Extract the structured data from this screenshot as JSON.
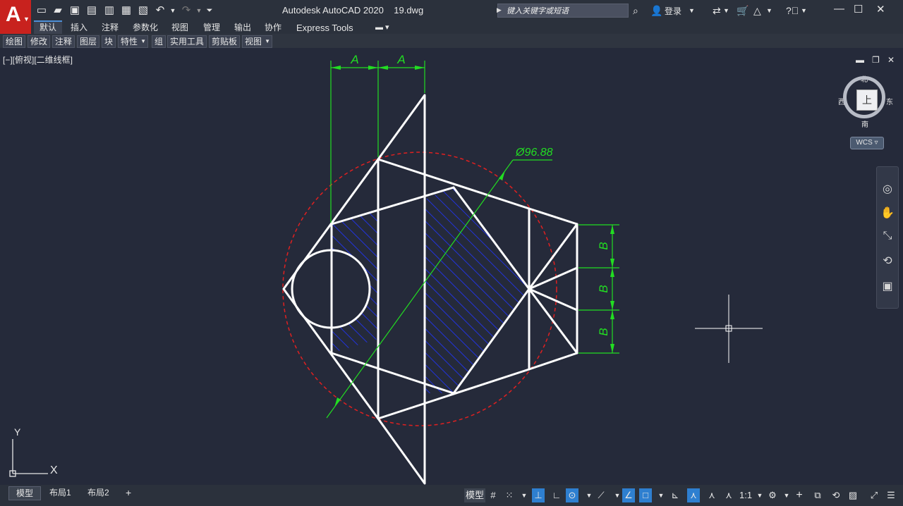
{
  "titlebar": {
    "app_logo": "A",
    "app_title": "Autodesk AutoCAD 2020",
    "file_name": "19.dwg",
    "search_placeholder": "键入关键字或短语",
    "login_label": "登录"
  },
  "ribbon_tabs": [
    "默认",
    "插入",
    "注释",
    "参数化",
    "视图",
    "管理",
    "输出",
    "协作",
    "Express Tools"
  ],
  "panels": [
    "绘图",
    "修改",
    "注释",
    "图层",
    "块",
    "特性",
    "组",
    "实用工具",
    "剪贴板",
    "视图"
  ],
  "viewport": {
    "view_label": "[−][俯视][二维线框]"
  },
  "viewcube": {
    "north": "北",
    "south": "南",
    "east": "东",
    "west": "西",
    "face": "上",
    "wcs_label": "WCS"
  },
  "drawing": {
    "dim_A": "A",
    "dim_B": "B",
    "diameter_label": "Ø96.88",
    "axis_x": "X",
    "axis_y": "Y",
    "colors": {
      "geometry": "#ffffff",
      "dimension": "#22dd22",
      "circle": "#e02020",
      "hatch": "#2233dd",
      "background": "#252a3a"
    }
  },
  "layout_tabs": [
    "模型",
    "布局1",
    "布局2"
  ],
  "add_layout_label": "+",
  "status": {
    "model_label": "模型",
    "scale_label": "1:1"
  }
}
